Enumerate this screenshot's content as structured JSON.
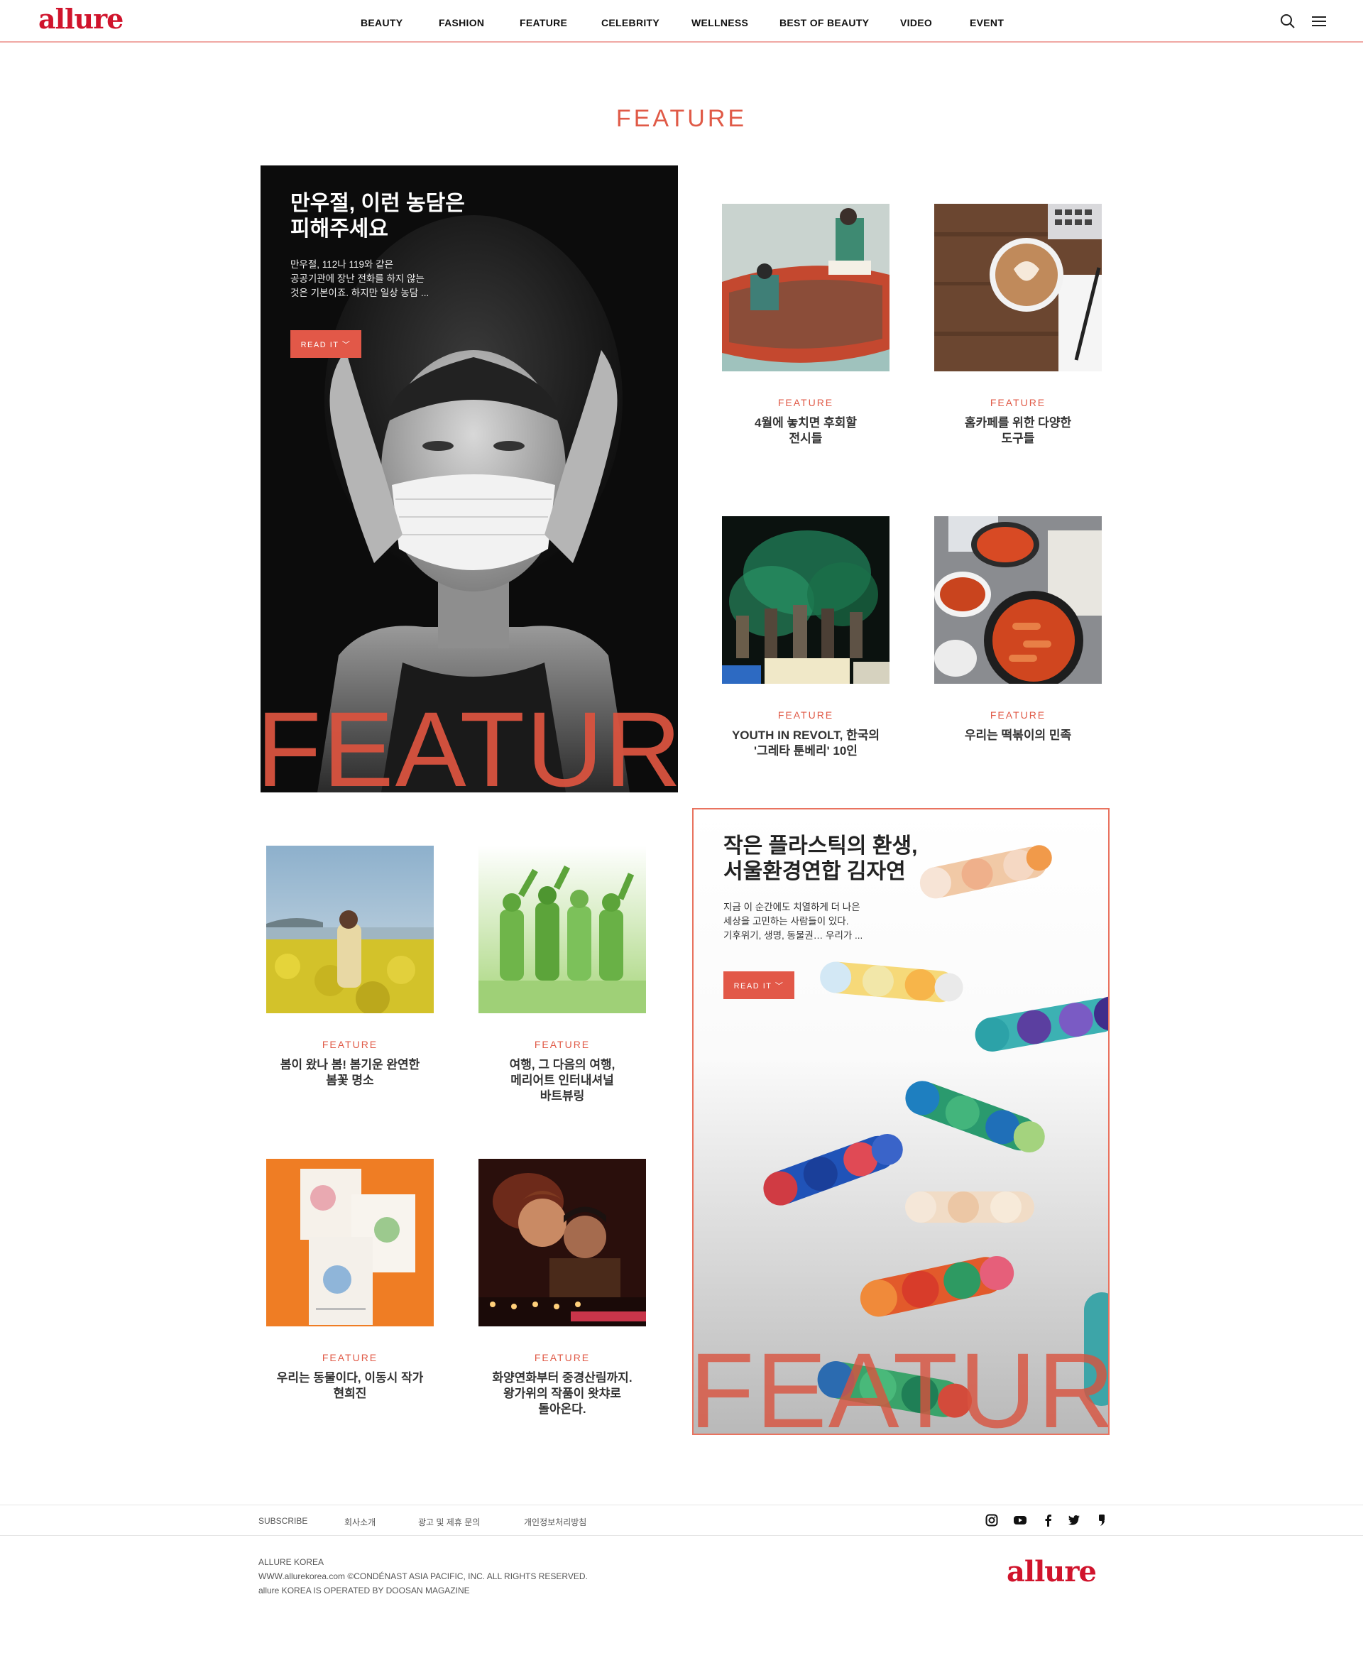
{
  "brand": {
    "logo": "allure",
    "color": "#d0142c"
  },
  "nav": {
    "items": [
      "BEAUTY",
      "FASHION",
      "FEATURE",
      "CELEBRITY",
      "WELLNESS",
      "BEST OF BEAUTY",
      "VIDEO",
      "EVENT"
    ],
    "icons": [
      "search-icon",
      "menu-icon"
    ]
  },
  "page": {
    "title": "FEATURE",
    "accent": "#e05a47"
  },
  "hero1": {
    "title": "만우절, 이런 농담은\n피해주세요",
    "desc": "만우절, 112나 119와 같은\n공공기관에 장난 전화를 하지 않는\n것은 기본이죠. 하지만 일상 농담 ...",
    "button": "READ IT ﹀",
    "watermark": "FEATURE"
  },
  "hero2": {
    "title": "작은 플라스틱의 환생,\n서울환경연합 김자연",
    "desc": "지금 이 순간에도 치열하게 더 나은\n세상을 고민하는 사람들이 있다.\n기후위기, 생명, 동물권… 우리가 ...",
    "button": "READ IT ﹀",
    "watermark": "FEATURE"
  },
  "cards": [
    {
      "category": "FEATURE",
      "title": "4월에 놓치면 후회할\n전시들"
    },
    {
      "category": "FEATURE",
      "title": "홈카페를 위한 다양한\n도구들"
    },
    {
      "category": "FEATURE",
      "title": "YOUTH IN REVOLT, 한국의\n'그레타 툰베리' 10인"
    },
    {
      "category": "FEATURE",
      "title": "우리는 떡볶이의 민족"
    },
    {
      "category": "FEATURE",
      "title": "봄이 왔나 봄! 봄기운 완연한\n봄꽃 명소"
    },
    {
      "category": "FEATURE",
      "title": "여행, 그 다음의 여행,\n메리어트 인터내셔널\n바트뷰링"
    },
    {
      "category": "FEATURE",
      "title": "우리는 동물이다, 이동시 작가\n현희진"
    },
    {
      "category": "FEATURE",
      "title": "화양연화부터 중경산림까지.\n왕가위의 작품이 왓챠로\n돌아온다."
    }
  ],
  "footer": {
    "links": [
      "SUBSCRIBE",
      "회사소개",
      "광고 및 제휴 문의",
      "개인정보처리방침"
    ],
    "social": [
      "instagram-icon",
      "youtube-icon",
      "facebook-icon",
      "twitter-icon",
      "naver-post-icon"
    ],
    "info": [
      "ALLURE KOREA",
      "WWW.allurekorea.com ©CONDÉNAST ASIA PACIFIC, INC. ALL RIGHTS RESERVED.",
      "allure KOREA IS OPERATED BY DOOSAN MAGAZINE"
    ],
    "logo": "allure"
  }
}
